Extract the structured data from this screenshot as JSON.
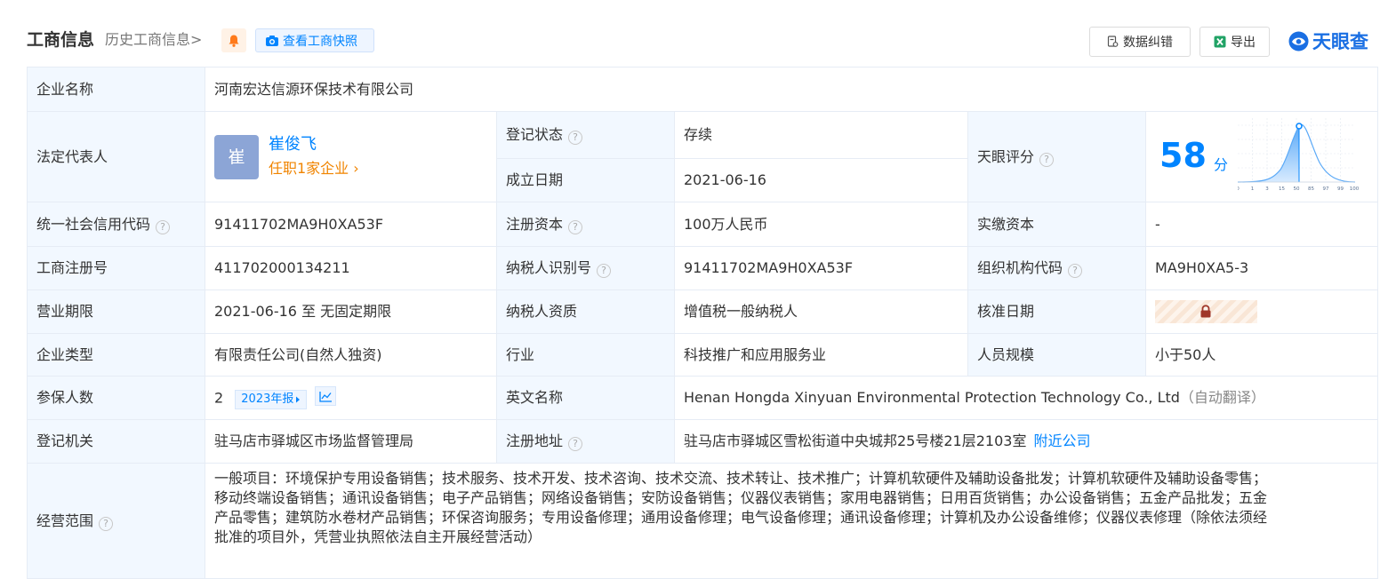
{
  "header": {
    "title": "工商信息",
    "history_label": "历史工商信息",
    "history_arrow": ">",
    "snapshot_label": "查看工商快照",
    "correction_label": "数据纠错",
    "export_label": "导出",
    "logo_text": "天眼查"
  },
  "colors": {
    "accent": "#0084ff",
    "label_bg": "#f2f8ff",
    "status_green": "#21a366",
    "position_orange": "#f08400",
    "logo_blue": "#1a6fe3"
  },
  "table": {
    "company_name": {
      "label": "企业名称",
      "value": "河南宏达信源环保技术有限公司"
    },
    "legal_rep": {
      "label": "法定代表人",
      "avatar_char": "崔",
      "name": "崔俊飞",
      "position": "任职1家企业",
      "position_arrow": "›"
    },
    "reg_status": {
      "label": "登记状态",
      "value": "存续"
    },
    "established": {
      "label": "成立日期",
      "value": "2021-06-16"
    },
    "score": {
      "label": "天眼评分",
      "value": "58",
      "unit": "分",
      "axis_ticks": [
        "0",
        "1",
        "3",
        "15",
        "50",
        "85",
        "97",
        "99",
        "100"
      ],
      "marker_percentile": 58
    },
    "credit_code": {
      "label": "统一社会信用代码",
      "value": "91411702MA9H0XA53F"
    },
    "reg_capital": {
      "label": "注册资本",
      "value": "100万人民币"
    },
    "paid_capital": {
      "label": "实缴资本",
      "value": "-"
    },
    "reg_number": {
      "label": "工商注册号",
      "value": "411702000134211"
    },
    "taxpayer_id": {
      "label": "纳税人识别号",
      "value": "91411702MA9H0XA53F"
    },
    "org_code": {
      "label": "组织机构代码",
      "value": "MA9H0XA5-3"
    },
    "biz_term": {
      "label": "营业期限",
      "value": "2021-06-16 至 无固定期限"
    },
    "taxpayer_qual": {
      "label": "纳税人资质",
      "value": "增值税一般纳税人"
    },
    "approval_date": {
      "label": "核准日期"
    },
    "company_type": {
      "label": "企业类型",
      "value": "有限责任公司(自然人独资)"
    },
    "industry": {
      "label": "行业",
      "value": "科技推广和应用服务业"
    },
    "staff_size": {
      "label": "人员规模",
      "value": "小于50人"
    },
    "insured": {
      "label": "参保人数",
      "value": "2",
      "year_tag": "2023年报"
    },
    "english_name": {
      "label": "英文名称",
      "value": "Henan Hongda Xinyuan Environmental Protection Technology Co., Ltd",
      "note": "（自动翻译）"
    },
    "reg_authority": {
      "label": "登记机关",
      "value": "驻马店市驿城区市场监督管理局"
    },
    "reg_address": {
      "label": "注册地址",
      "value": "驻马店市驿城区雪松街道中央城邦25号楼21层2103室",
      "link": "附近公司"
    },
    "business_scope": {
      "label": "经营范围",
      "lines": [
        "一般项目：环境保护专用设备销售；技术服务、技术开发、技术咨询、技术交流、技术转让、技术推广；计算机软硬件及辅助设备批发；计算机软硬件及辅助设备零售；",
        "移动终端设备销售；通讯设备销售；电子产品销售；网络设备销售；安防设备销售；仪器仪表销售；家用电器销售；日用百货销售；办公设备销售；五金产品批发；五金",
        "产品零售；建筑防水卷材产品销售；环保咨询服务；专用设备修理；通用设备修理；电气设备修理；通讯设备修理；计算机及办公设备维修；仪器仪表修理（除依法须经",
        "批准的项目外，凭营业执照依法自主开展经营活动）"
      ]
    }
  }
}
